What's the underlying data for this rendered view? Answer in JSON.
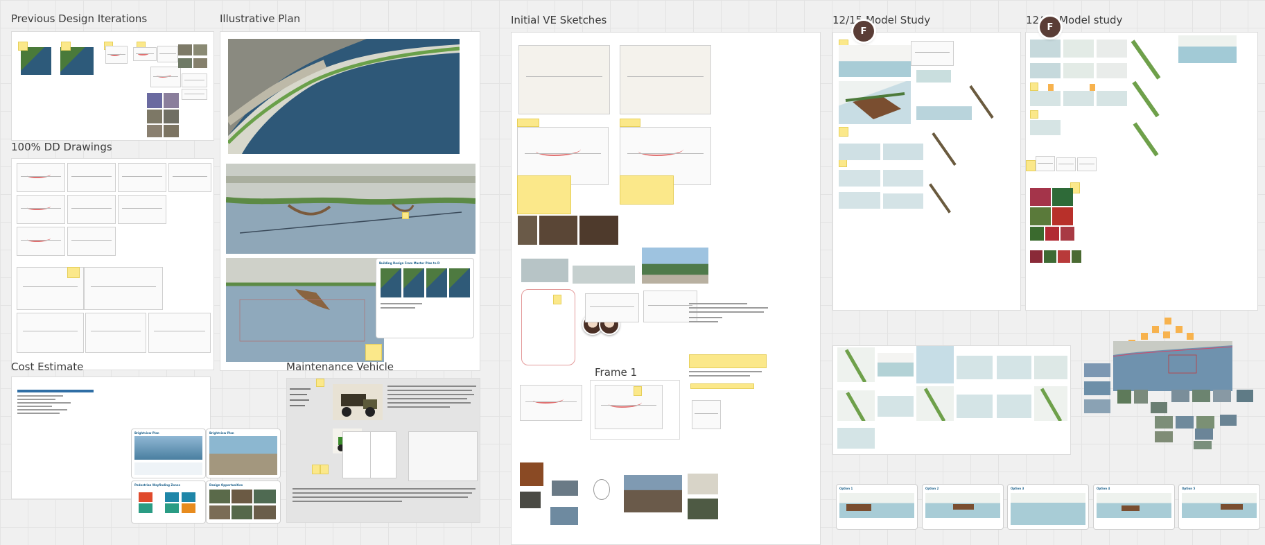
{
  "board": {
    "frames": {
      "prev_design": "Previous Design Iterations",
      "illustrative_plan": "Illustrative Plan",
      "initial_ve": "Initial VE Sketches",
      "model_1215": "12/15 Model Study",
      "model_1219": "12/19 Model study",
      "dd_drawings": "100% DD Drawings",
      "cost_estimate": "Cost Estimate",
      "maintenance": "Maintenance Vehicle",
      "frame1": "Frame 1"
    },
    "collaborators": [
      {
        "initial": "F"
      },
      {
        "initial": "F"
      }
    ],
    "colors": {
      "canvas": "#f0f0f0",
      "sticky": "#fbe88a",
      "orange_sticky": "#f7b24d",
      "water": "#2e5878",
      "avatar": "#5a3d36"
    }
  }
}
